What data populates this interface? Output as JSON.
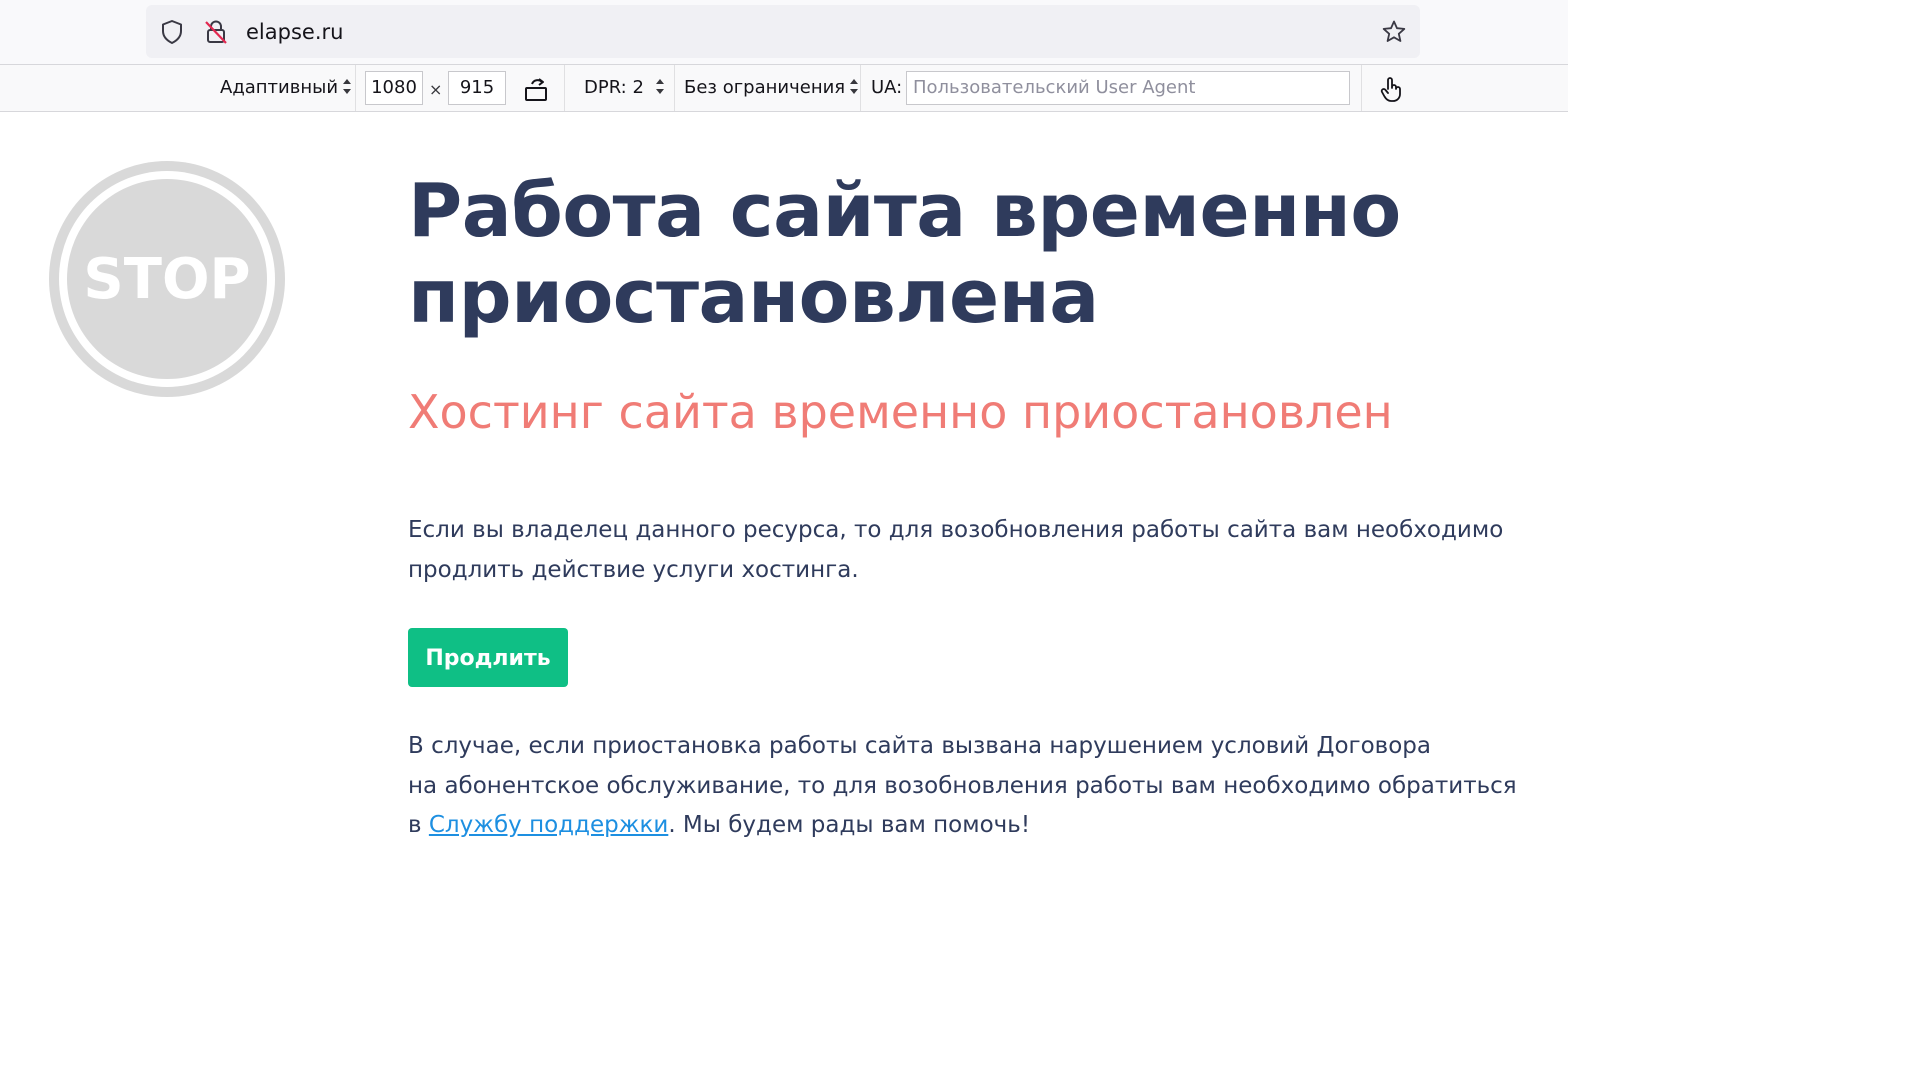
{
  "browser": {
    "url": "elapse.ru"
  },
  "rdm_toolbar": {
    "device": "Адаптивный",
    "width": "1080",
    "times": "×",
    "height": "915",
    "dpr": "DPR: 2",
    "throttling": "Без ограничения",
    "ua_label": "UA:",
    "ua_placeholder": "Пользовательский User Agent"
  },
  "page": {
    "stop_text": "STOP",
    "title_line1": "Работа сайта временно",
    "title_line2": "приостановлена",
    "subtitle": "Хостинг сайта временно приостановлен",
    "paragraph1": "Если вы владелец данного ресурса, то для возобновления работы сайта вам необходимо продлить действие услуги хостинга.",
    "renew_button": "Продлить",
    "paragraph2_line1": "В случае, если приостановка работы сайта вызвана нарушением условий Договора",
    "paragraph2_line2": "на абонентское обслуживание, то для возобновления работы вам необходимо обратиться",
    "paragraph2_prefix": "в ",
    "support_link": "Службу поддержки",
    "paragraph2_suffix": ". Мы будем рады вам помочь!"
  },
  "colors": {
    "title": "#2f3b5c",
    "subtitle": "#f07c76",
    "button": "#0fbf85",
    "link": "#1d8fe1",
    "stop_sign": "#d9d9d9"
  }
}
